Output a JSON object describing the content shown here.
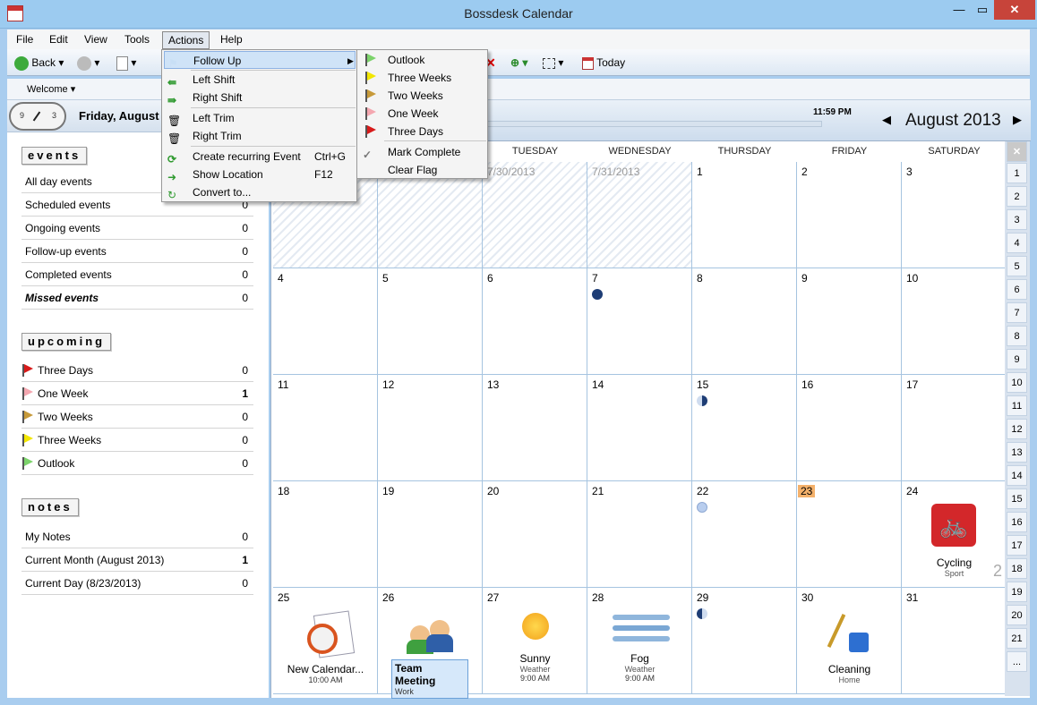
{
  "window": {
    "title": "Bossdesk Calendar",
    "close_label": "✕",
    "maximize_label": "▭",
    "minimize_label": "—"
  },
  "menubar": [
    "File",
    "Edit",
    "View",
    "Tools",
    "Actions",
    "Help"
  ],
  "toolbar": {
    "back_label": "Back",
    "today_label": "Today"
  },
  "welcome": {
    "label": "Welcome"
  },
  "left": {
    "date": "Friday, August",
    "events_title": "events",
    "events": [
      {
        "label": "All day events",
        "count": "0"
      },
      {
        "label": "Scheduled events",
        "count": "0"
      },
      {
        "label": "Ongoing events",
        "count": "0"
      },
      {
        "label": "Follow-up events",
        "count": "0"
      },
      {
        "label": "Completed events",
        "count": "0"
      },
      {
        "label": "Missed events",
        "count": "0"
      }
    ],
    "upcoming_title": "upcoming",
    "upcoming": [
      {
        "label": "Three Days",
        "count": "0",
        "color": "#d81b1b"
      },
      {
        "label": "One Week",
        "count": "1",
        "color": "#f4a7b0"
      },
      {
        "label": "Two Weeks",
        "count": "0",
        "color": "#c79a3a"
      },
      {
        "label": "Three Weeks",
        "count": "0",
        "color": "#f2e600"
      },
      {
        "label": "Outlook",
        "count": "0",
        "color": "#7cd36b"
      }
    ],
    "notes_title": "notes",
    "notes": [
      {
        "label": "My Notes",
        "count": "0"
      },
      {
        "label": "Current Month (August 2013)",
        "count": "1"
      },
      {
        "label": "Current Day (8/23/2013)",
        "count": "0"
      }
    ]
  },
  "calendar": {
    "month_title": "August 2013",
    "time_label": "11:59 PM",
    "day_headers": [
      "TUESDAY",
      "WEDNESDAY",
      "THURSDAY",
      "FRIDAY",
      "SATURDAY"
    ],
    "prev_dates": [
      "7/30/2013",
      "7/31/2013"
    ],
    "week_numbers": [
      "1",
      "2",
      "3",
      "4",
      "5",
      "6",
      "7",
      "8",
      "9",
      "10",
      "11",
      "12",
      "13",
      "14",
      "15",
      "16",
      "17",
      "18",
      "19",
      "20",
      "21",
      "..."
    ],
    "days": [
      "1",
      "2",
      "3",
      "4",
      "5",
      "6",
      "7",
      "8",
      "9",
      "10",
      "11",
      "12",
      "13",
      "14",
      "15",
      "16",
      "17",
      "18",
      "19",
      "20",
      "21",
      "22",
      "23",
      "24",
      "25",
      "26",
      "27",
      "28",
      "29",
      "30",
      "31"
    ],
    "events": {
      "cycling": {
        "name": "Cycling",
        "sub": "Sport",
        "count": "2"
      },
      "new_cal": {
        "name": "New Calendar...",
        "time": "10:00 AM"
      },
      "meeting": {
        "name": "Team Meeting",
        "sub": "Work"
      },
      "sunny": {
        "name": "Sunny",
        "sub": "Weather",
        "time": "9:00 AM"
      },
      "fog": {
        "name": "Fog",
        "sub": "Weather",
        "time": "9:00 AM"
      },
      "cleaning": {
        "name": "Cleaning",
        "sub": "Home"
      }
    }
  },
  "actions_menu": {
    "follow_up": "Follow Up",
    "left_shift": "Left Shift",
    "right_shift": "Right Shift",
    "left_trim": "Left Trim",
    "right_trim": "Right Trim",
    "create_recurring": "Create recurring Event",
    "create_recurring_key": "Ctrl+G",
    "show_location": "Show Location",
    "show_location_key": "F12",
    "convert_to": "Convert to..."
  },
  "followup_menu": {
    "outlook": "Outlook",
    "three_weeks": "Three Weeks",
    "two_weeks": "Two Weeks",
    "one_week": "One Week",
    "three_days": "Three Days",
    "mark_complete": "Mark Complete",
    "clear_flag": "Clear Flag"
  }
}
